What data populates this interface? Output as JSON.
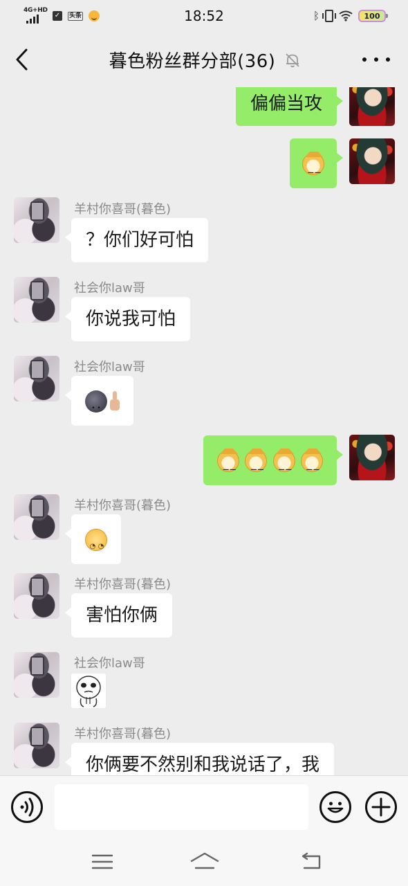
{
  "status_bar": {
    "network_label": "4G+HD",
    "app_icon_text": "头条",
    "time": "18:52",
    "battery": "100"
  },
  "header": {
    "title": "暮色粉丝群分部(36)"
  },
  "messages": [
    {
      "side": "right",
      "text": "偏偏当攻"
    },
    {
      "side": "right",
      "emoji": [
        "doge"
      ]
    },
    {
      "side": "left",
      "sender": "羊村你喜哥(暮色)",
      "text": "？你们好可怕"
    },
    {
      "side": "left",
      "sender": "社会你law哥",
      "text": "你说我可怕"
    },
    {
      "side": "left",
      "sender": "社会你law哥",
      "emoji": [
        "new-moon-face",
        "middle-finger"
      ]
    },
    {
      "side": "right",
      "emoji": [
        "doge",
        "doge",
        "doge",
        "doge"
      ]
    },
    {
      "side": "left",
      "sender": "羊村你喜哥(暮色)",
      "emoji": [
        "pleading-face"
      ]
    },
    {
      "side": "left",
      "sender": "羊村你喜哥(暮色)",
      "text": "害怕你俩"
    },
    {
      "side": "left",
      "sender": "社会你law哥",
      "sticker": "cartoon-face-sticker"
    },
    {
      "side": "left",
      "sender": "羊村你喜哥(暮色)",
      "text": "你俩要不然别和我说话了，我"
    }
  ],
  "input": {
    "value": ""
  },
  "colors": {
    "background": "#ededed",
    "bubble_me": "#95ec69",
    "bubble_other": "#ffffff",
    "sender_name": "#8a8a8a"
  },
  "icons": {
    "back": "chevron-left-icon",
    "mute": "bell-off-icon",
    "more": "more-dots-icon",
    "voice": "voice-icon",
    "emoji": "smiley-icon",
    "plus": "plus-icon",
    "menu": "menu-icon",
    "home": "home-icon",
    "return": "back-arrow-icon"
  }
}
